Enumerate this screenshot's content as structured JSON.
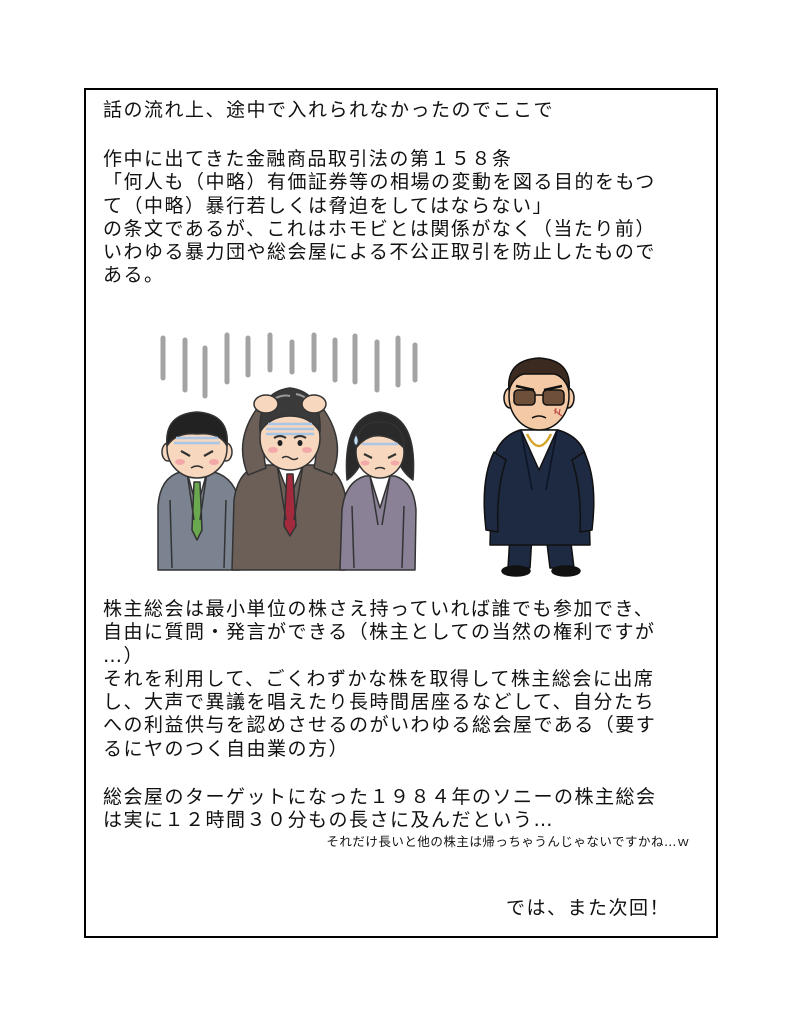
{
  "intro": {
    "lines": [
      "話の流れ上、途中で入れられなかったのでここで"
    ]
  },
  "law": {
    "lines": [
      "作中に出てきた金融商品取引法の第１５８条",
      "「何人も（中略）有価証券等の相場の変動を図る目的をもつ",
      "て（中略）暴行若しくは脅迫をしてはならない」",
      "の条文であるが、これはホモビとは関係がなく（当たり前）",
      "いわゆる暴力団や総会屋による不公正取引を防止したもので",
      "ある。"
    ]
  },
  "explanation": {
    "lines": [
      "株主総会は最小単位の株さえ持っていれば誰でも参加でき、",
      "自由に質問・発言ができる（株主としての当然の権利ですが",
      "…）",
      "それを利用して、ごくわずかな株を取得して株主総会に出席",
      "し、大声で異議を唱えたり長時間居座るなどして、自分たち",
      "への利益供与を認めさせるのがいわゆる総会屋である（要す",
      "るにヤのつく自由業の方）"
    ]
  },
  "sony": {
    "lines": [
      "総会屋のターゲットになった１９８４年のソニーの株主総会",
      "は実に１２時間３０分もの長さに及んだという…"
    ],
    "aside": "それだけ長いと他の株主は帰っちゃうんじゃないですかね…ｗ"
  },
  "closing": "では、また次回！"
}
